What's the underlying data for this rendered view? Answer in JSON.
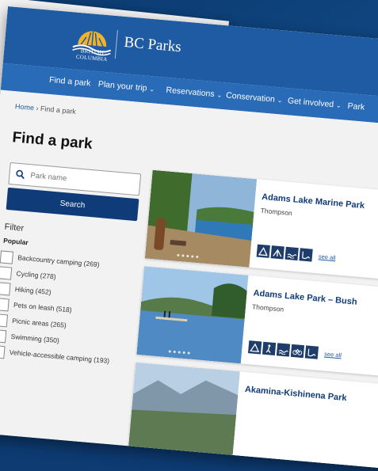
{
  "header": {
    "logo_lines": [
      "BRITISH",
      "COLUMBIA"
    ],
    "brand": "BC Parks"
  },
  "nav": {
    "items": [
      {
        "label": "Find a park",
        "dropdown": false
      },
      {
        "label": "Plan your trip",
        "dropdown": true
      },
      {
        "label": "Reservations",
        "dropdown": true
      },
      {
        "label": "Conservation",
        "dropdown": true
      },
      {
        "label": "Get involved",
        "dropdown": true
      },
      {
        "label": "Park",
        "dropdown": false
      }
    ]
  },
  "breadcrumb": {
    "home": "Home",
    "separator": "›",
    "current": "Find a park"
  },
  "page_title": "Find a park",
  "search": {
    "placeholder": "Park name",
    "button": "Search"
  },
  "filter": {
    "title": "Filter",
    "group": "Popular",
    "items": [
      "Backcountry camping (269)",
      "Cycling (278)",
      "Hiking (452)",
      "Pets on leash (518)",
      "Picnic areas (265)",
      "Swimming (350)",
      "Vehicle-accessible camping (193)"
    ]
  },
  "parks": [
    {
      "name": "Adams Lake Marine Park",
      "region": "Thompson",
      "see_all": "see all"
    },
    {
      "name": "Adams Lake Park – Bush",
      "region": "Thompson",
      "see_all": "see all"
    },
    {
      "name": "Akamina-Kishinena Park",
      "region": "",
      "see_all": ""
    }
  ],
  "colors": {
    "header": "#1f5ba3",
    "nav": "#2a6bb8",
    "button": "#0f3c78",
    "link": "#0f3c78",
    "background": "#0d3b72"
  }
}
